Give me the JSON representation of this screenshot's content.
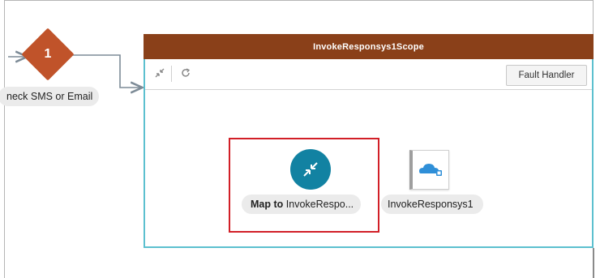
{
  "switch_node": {
    "number": "1",
    "label": "neck SMS or Email"
  },
  "scope": {
    "title": "InvokeResponsys1Scope",
    "fault_handler_label": "Fault Handler"
  },
  "toolbar": {
    "collapse_icon": "collapse-arrows-icon",
    "refresh_icon": "refresh-icon"
  },
  "flow": {
    "mapper": {
      "label_bold": "Map to",
      "label_rest": "InvokeRespo..."
    },
    "invoke": {
      "label": "InvokeResponsys1",
      "icon": "cloud-adapter-icon"
    }
  },
  "colors": {
    "switch": "#c0532a",
    "scope_header": "#8a4019",
    "scope_border": "#5cc0cf",
    "mapper": "#1282a2",
    "highlight": "#d21f27",
    "cloud": "#2f8fd8"
  }
}
